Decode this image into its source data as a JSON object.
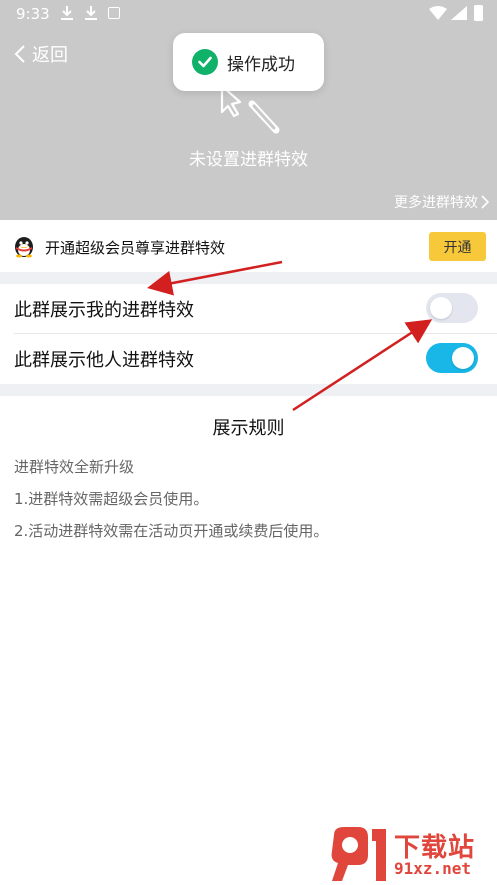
{
  "status_bar": {
    "time": "9:33",
    "icons": [
      "download-icon",
      "download-icon",
      "a-icon",
      "wifi-icon",
      "signal-icon",
      "battery-icon"
    ]
  },
  "nav": {
    "back_label": "返回"
  },
  "toast": {
    "label": "操作成功",
    "icon": "check-circle-icon",
    "color": "#10b26a"
  },
  "effect_preview": {
    "empty_label": "未设置进群特效",
    "more_label": "更多进群特效"
  },
  "vip_banner": {
    "text": "开通超级会员尊享进群特效",
    "button_label": "开通",
    "button_color": "#f7c93a"
  },
  "settings": [
    {
      "label": "此群展示我的进群特效",
      "enabled": false
    },
    {
      "label": "此群展示他人进群特效",
      "enabled": true
    }
  ],
  "toggle_on_color": "#19b7e8",
  "rules": {
    "title": "展示规则",
    "lines": [
      "进群特效全新升级",
      "1.进群特效需超级会员使用。",
      "2.活动进群特效需在活动页开通或续费后使用。"
    ]
  },
  "watermark": {
    "logo_text": "91",
    "title": "下载站",
    "url": "91xz.net"
  }
}
